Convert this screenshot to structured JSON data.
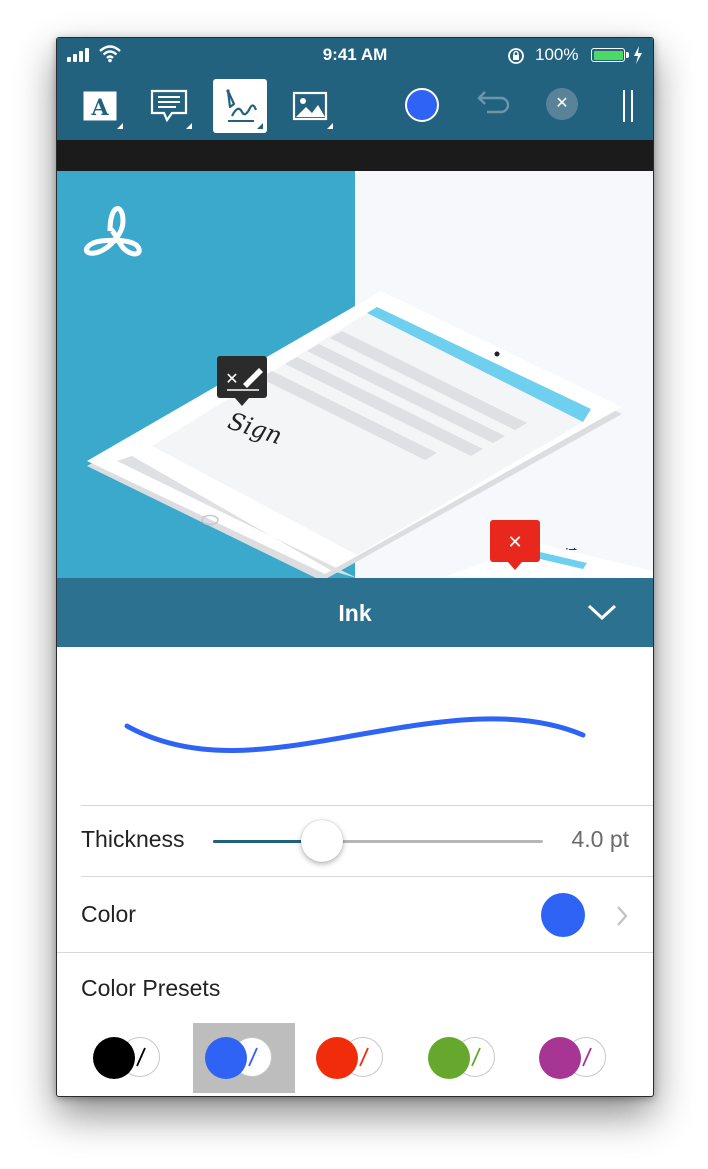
{
  "status_bar": {
    "time": "9:41 AM",
    "battery_percent": "100%",
    "icons": [
      "signal-icon",
      "wifi-icon",
      "rotation-lock-icon",
      "battery-icon",
      "charging-bolt-icon"
    ]
  },
  "toolbar": {
    "tools": [
      {
        "name": "text-tool",
        "icon": "text-box-icon",
        "active": false
      },
      {
        "name": "comment-tool",
        "icon": "comment-bubble-icon",
        "active": false
      },
      {
        "name": "ink-tool",
        "icon": "pen-signature-icon",
        "active": true
      },
      {
        "name": "image-tool",
        "icon": "image-icon",
        "active": false
      }
    ],
    "current_color": "#2f63f5",
    "undo_icon": "undo-icon",
    "close_icon": "close-icon",
    "close_glyph": "✕"
  },
  "document": {
    "logo_icon": "acrobat-logo-icon",
    "sign_text": "Sign",
    "panel_color": "#3aa9cc"
  },
  "panel": {
    "title": "Ink",
    "collapse_icon": "chevron-down-icon"
  },
  "ink_settings": {
    "stroke_color": "#2f63f5",
    "thickness_label": "Thickness",
    "thickness_value": "4.0 pt",
    "thickness_fraction": 0.33,
    "color_label": "Color",
    "color_value": "#2f63f5",
    "presets_label": "Color Presets",
    "presets": [
      {
        "color": "#000000",
        "selected": false
      },
      {
        "color": "#2f63f5",
        "selected": true
      },
      {
        "color": "#f12c0b",
        "selected": false
      },
      {
        "color": "#66a82d",
        "selected": false
      },
      {
        "color": "#a63594",
        "selected": false
      }
    ]
  }
}
